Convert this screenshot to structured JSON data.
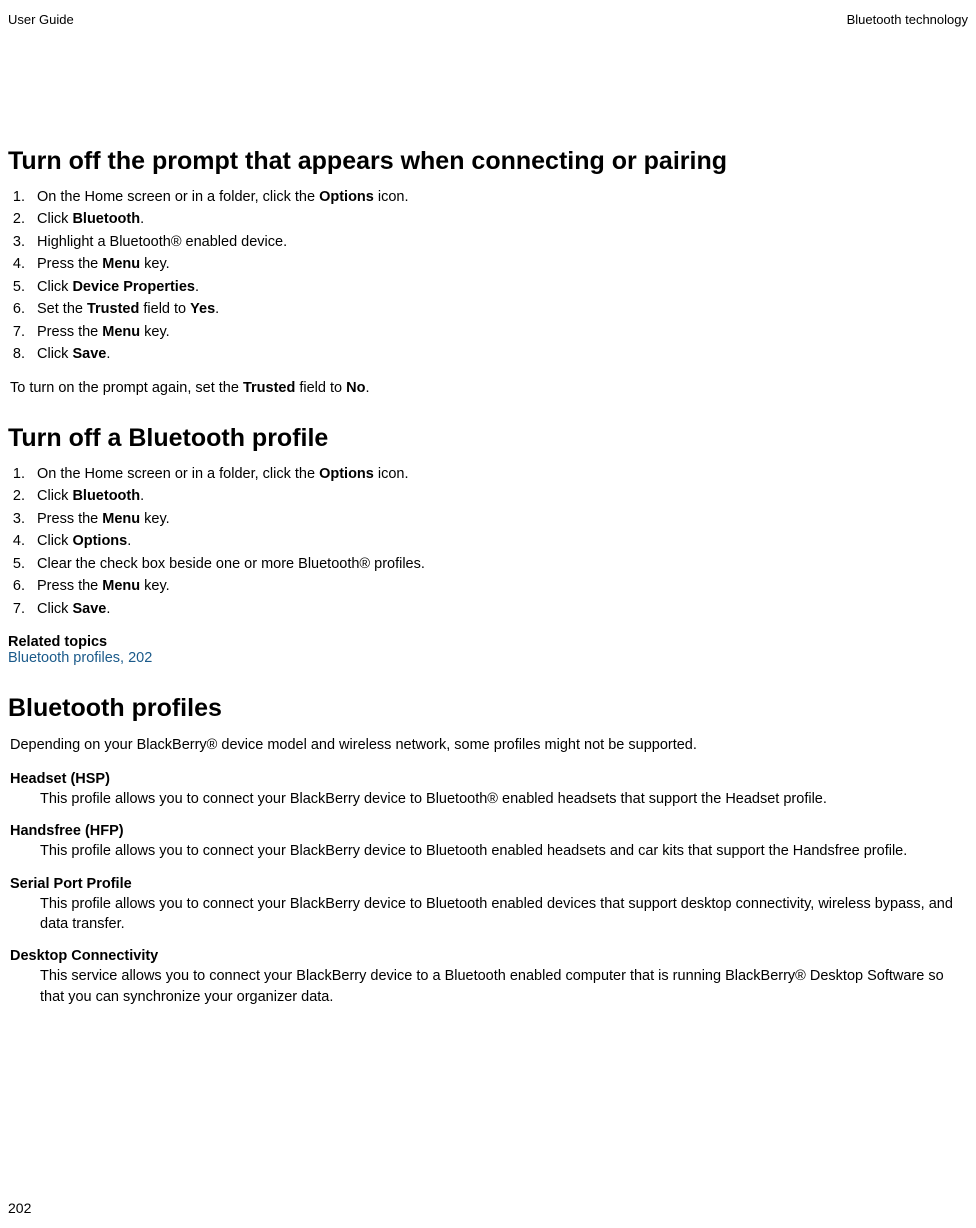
{
  "header": {
    "left": "User Guide",
    "right": "Bluetooth technology"
  },
  "section1": {
    "heading": "Turn off the prompt that appears when connecting or pairing",
    "steps": [
      {
        "pre": "On the Home screen or in a folder, click the ",
        "bold": "Options",
        "post": " icon."
      },
      {
        "pre": "Click ",
        "bold": "Bluetooth",
        "post": "."
      },
      {
        "pre": "Highlight a Bluetooth® enabled device.",
        "bold": "",
        "post": ""
      },
      {
        "pre": "Press the ",
        "bold": "Menu",
        "post": " key."
      },
      {
        "pre": "Click ",
        "bold": "Device Properties",
        "post": "."
      },
      {
        "pre": "Set the ",
        "bold": "Trusted",
        "post": " field to ",
        "bold2": "Yes",
        "post2": "."
      },
      {
        "pre": "Press the ",
        "bold": "Menu",
        "post": " key."
      },
      {
        "pre": "Click ",
        "bold": "Save",
        "post": "."
      }
    ],
    "note_pre": "To turn on the prompt again, set the ",
    "note_bold1": "Trusted",
    "note_mid": " field to ",
    "note_bold2": "No",
    "note_post": "."
  },
  "section2": {
    "heading": "Turn off a Bluetooth profile",
    "steps": [
      {
        "pre": "On the Home screen or in a folder, click the ",
        "bold": "Options",
        "post": " icon."
      },
      {
        "pre": "Click ",
        "bold": "Bluetooth",
        "post": "."
      },
      {
        "pre": "Press the ",
        "bold": "Menu",
        "post": " key."
      },
      {
        "pre": "Click ",
        "bold": "Options",
        "post": "."
      },
      {
        "pre": "Clear the check box beside one or more Bluetooth® profiles.",
        "bold": "",
        "post": ""
      },
      {
        "pre": "Press the ",
        "bold": "Menu",
        "post": " key."
      },
      {
        "pre": "Click ",
        "bold": "Save",
        "post": "."
      }
    ],
    "related_heading": "Related topics",
    "related_link": "Bluetooth profiles, 202"
  },
  "section3": {
    "heading": "Bluetooth profiles",
    "intro": "Depending on your BlackBerry® device model and wireless network, some profiles might not be supported.",
    "profiles": [
      {
        "term": "Headset (HSP)",
        "desc": "This profile allows you to connect your BlackBerry device to Bluetooth® enabled headsets that support the Headset profile."
      },
      {
        "term": "Handsfree (HFP)",
        "desc": "This profile allows you to connect your BlackBerry device to Bluetooth enabled headsets and car kits that support the Handsfree profile."
      },
      {
        "term": "Serial Port Profile",
        "desc": "This profile allows you to connect your BlackBerry device to Bluetooth enabled devices that support desktop connectivity, wireless bypass, and data transfer."
      },
      {
        "term": "Desktop Connectivity",
        "desc": "This service allows you to connect your BlackBerry device to a Bluetooth enabled computer that is running BlackBerry® Desktop Software so that you can synchronize your organizer data."
      }
    ]
  },
  "page_number": "202"
}
